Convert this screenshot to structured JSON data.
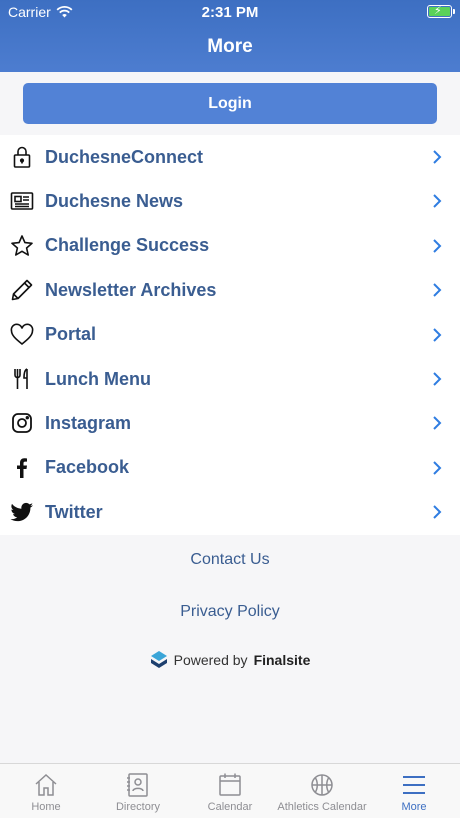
{
  "status_bar": {
    "carrier": "Carrier",
    "time": "2:31 PM"
  },
  "header": {
    "title": "More"
  },
  "login": {
    "label": "Login"
  },
  "menu": {
    "items": [
      {
        "label": "DuchesneConnect",
        "icon": "lock-icon"
      },
      {
        "label": "Duchesne News",
        "icon": "newspaper-icon"
      },
      {
        "label": "Challenge Success",
        "icon": "star-icon"
      },
      {
        "label": "Newsletter Archives",
        "icon": "pencil-icon"
      },
      {
        "label": "Portal",
        "icon": "heart-icon"
      },
      {
        "label": "Lunch Menu",
        "icon": "utensils-icon"
      },
      {
        "label": "Instagram",
        "icon": "instagram-icon"
      },
      {
        "label": "Facebook",
        "icon": "facebook-icon"
      },
      {
        "label": "Twitter",
        "icon": "twitter-icon"
      }
    ]
  },
  "footer": {
    "contact_label": "Contact Us",
    "privacy_label": "Privacy Policy",
    "powered_prefix": "Powered by",
    "powered_brand": "Finalsite"
  },
  "tabs": [
    {
      "label": "Home",
      "icon": "home-icon",
      "active": false
    },
    {
      "label": "Directory",
      "icon": "directory-icon",
      "active": false
    },
    {
      "label": "Calendar",
      "icon": "calendar-icon",
      "active": false
    },
    {
      "label": "Athletics Calendar",
      "icon": "basketball-icon",
      "active": false
    },
    {
      "label": "More",
      "icon": "menu-icon",
      "active": true
    }
  ],
  "colors": {
    "header": "#4d7dd0",
    "accent": "#3d6fc2",
    "link": "#3a5d91",
    "login_button": "#5282d6"
  }
}
